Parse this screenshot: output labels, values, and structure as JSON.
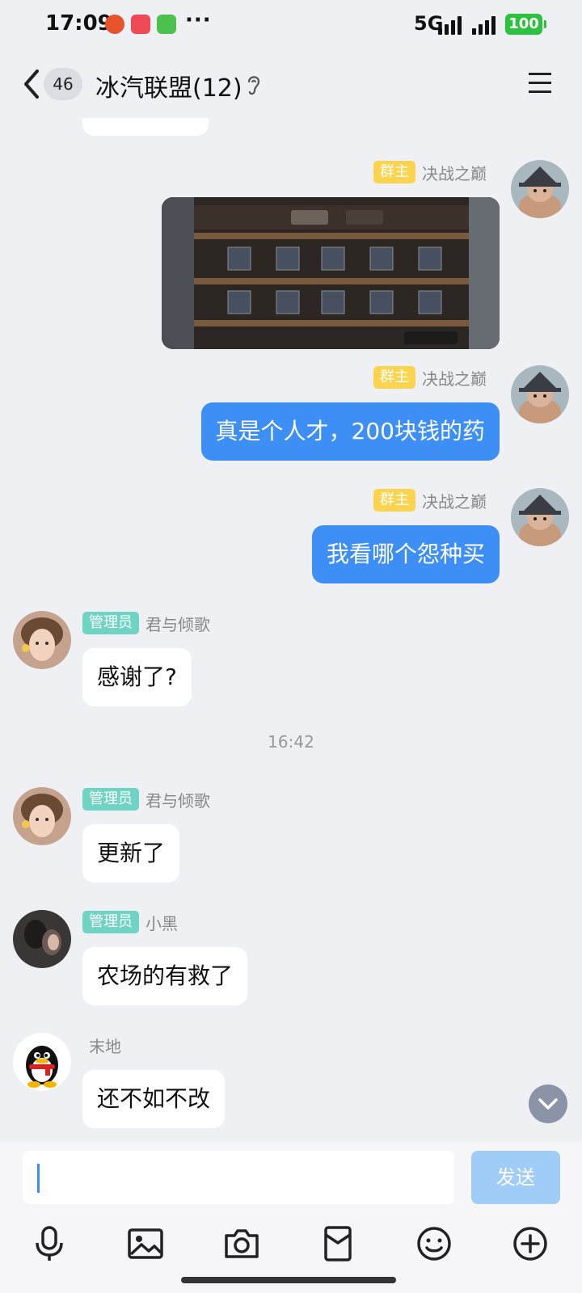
{
  "status_bar": {
    "time": "17:09",
    "network": "5G",
    "battery": "100",
    "more": "···"
  },
  "header": {
    "unread_count": "46",
    "title": "冰汽联盟(12)"
  },
  "messages": [
    {
      "id": "m1",
      "side": "out",
      "role": "群主",
      "nick": "决战之巅",
      "type": "image"
    },
    {
      "id": "m2",
      "side": "out",
      "role": "群主",
      "nick": "决战之巅",
      "text": "真是个人才，200块钱的药"
    },
    {
      "id": "m3",
      "side": "out",
      "role": "群主",
      "nick": "决战之巅",
      "text": "我看哪个怨种买"
    },
    {
      "id": "m4",
      "side": "in",
      "role": "管理员",
      "nick": "君与倾歌",
      "text": "感谢了?"
    },
    {
      "id": "m5",
      "side": "in",
      "role": "管理员",
      "nick": "君与倾歌",
      "text": "更新了"
    },
    {
      "id": "m6",
      "side": "in",
      "role": "管理员",
      "nick": "小黑",
      "text": "农场的有救了"
    },
    {
      "id": "m7",
      "side": "in",
      "role": "",
      "nick": "末地",
      "text": "还不如不改"
    }
  ],
  "timestamp": "16:42",
  "input": {
    "value": "",
    "send_label": "发送"
  },
  "toolbar": [
    "mic-icon",
    "image-icon",
    "camera-icon",
    "red-packet-icon",
    "emoji-icon",
    "plus-icon"
  ],
  "colors": {
    "outgoing": "#3d8ff5",
    "owner_badge": "#fbd34d",
    "admin_badge": "#6fd4c4",
    "send_disabled": "#9fcdf7"
  }
}
